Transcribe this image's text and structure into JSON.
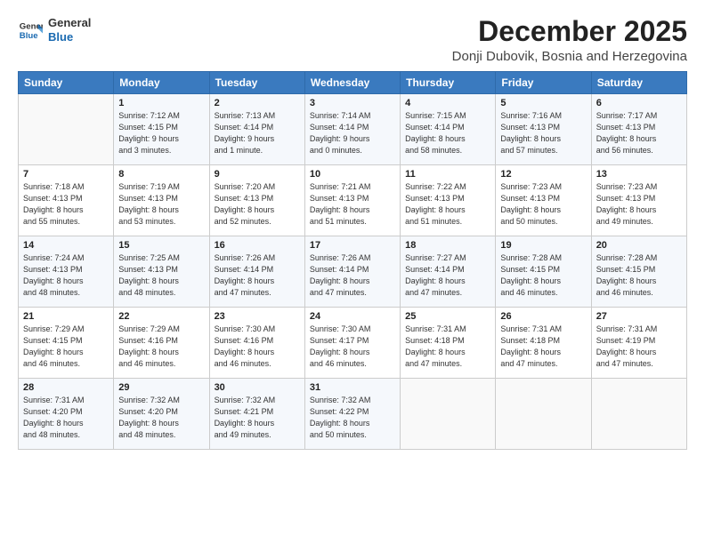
{
  "header": {
    "logo_line1": "General",
    "logo_line2": "Blue",
    "month": "December 2025",
    "location": "Donji Dubovik, Bosnia and Herzegovina"
  },
  "weekdays": [
    "Sunday",
    "Monday",
    "Tuesday",
    "Wednesday",
    "Thursday",
    "Friday",
    "Saturday"
  ],
  "weeks": [
    [
      {
        "day": "",
        "info": ""
      },
      {
        "day": "1",
        "info": "Sunrise: 7:12 AM\nSunset: 4:15 PM\nDaylight: 9 hours\nand 3 minutes."
      },
      {
        "day": "2",
        "info": "Sunrise: 7:13 AM\nSunset: 4:14 PM\nDaylight: 9 hours\nand 1 minute."
      },
      {
        "day": "3",
        "info": "Sunrise: 7:14 AM\nSunset: 4:14 PM\nDaylight: 9 hours\nand 0 minutes."
      },
      {
        "day": "4",
        "info": "Sunrise: 7:15 AM\nSunset: 4:14 PM\nDaylight: 8 hours\nand 58 minutes."
      },
      {
        "day": "5",
        "info": "Sunrise: 7:16 AM\nSunset: 4:13 PM\nDaylight: 8 hours\nand 57 minutes."
      },
      {
        "day": "6",
        "info": "Sunrise: 7:17 AM\nSunset: 4:13 PM\nDaylight: 8 hours\nand 56 minutes."
      }
    ],
    [
      {
        "day": "7",
        "info": "Sunrise: 7:18 AM\nSunset: 4:13 PM\nDaylight: 8 hours\nand 55 minutes."
      },
      {
        "day": "8",
        "info": "Sunrise: 7:19 AM\nSunset: 4:13 PM\nDaylight: 8 hours\nand 53 minutes."
      },
      {
        "day": "9",
        "info": "Sunrise: 7:20 AM\nSunset: 4:13 PM\nDaylight: 8 hours\nand 52 minutes."
      },
      {
        "day": "10",
        "info": "Sunrise: 7:21 AM\nSunset: 4:13 PM\nDaylight: 8 hours\nand 51 minutes."
      },
      {
        "day": "11",
        "info": "Sunrise: 7:22 AM\nSunset: 4:13 PM\nDaylight: 8 hours\nand 51 minutes."
      },
      {
        "day": "12",
        "info": "Sunrise: 7:23 AM\nSunset: 4:13 PM\nDaylight: 8 hours\nand 50 minutes."
      },
      {
        "day": "13",
        "info": "Sunrise: 7:23 AM\nSunset: 4:13 PM\nDaylight: 8 hours\nand 49 minutes."
      }
    ],
    [
      {
        "day": "14",
        "info": "Sunrise: 7:24 AM\nSunset: 4:13 PM\nDaylight: 8 hours\nand 48 minutes."
      },
      {
        "day": "15",
        "info": "Sunrise: 7:25 AM\nSunset: 4:13 PM\nDaylight: 8 hours\nand 48 minutes."
      },
      {
        "day": "16",
        "info": "Sunrise: 7:26 AM\nSunset: 4:14 PM\nDaylight: 8 hours\nand 47 minutes."
      },
      {
        "day": "17",
        "info": "Sunrise: 7:26 AM\nSunset: 4:14 PM\nDaylight: 8 hours\nand 47 minutes."
      },
      {
        "day": "18",
        "info": "Sunrise: 7:27 AM\nSunset: 4:14 PM\nDaylight: 8 hours\nand 47 minutes."
      },
      {
        "day": "19",
        "info": "Sunrise: 7:28 AM\nSunset: 4:15 PM\nDaylight: 8 hours\nand 46 minutes."
      },
      {
        "day": "20",
        "info": "Sunrise: 7:28 AM\nSunset: 4:15 PM\nDaylight: 8 hours\nand 46 minutes."
      }
    ],
    [
      {
        "day": "21",
        "info": "Sunrise: 7:29 AM\nSunset: 4:15 PM\nDaylight: 8 hours\nand 46 minutes."
      },
      {
        "day": "22",
        "info": "Sunrise: 7:29 AM\nSunset: 4:16 PM\nDaylight: 8 hours\nand 46 minutes."
      },
      {
        "day": "23",
        "info": "Sunrise: 7:30 AM\nSunset: 4:16 PM\nDaylight: 8 hours\nand 46 minutes."
      },
      {
        "day": "24",
        "info": "Sunrise: 7:30 AM\nSunset: 4:17 PM\nDaylight: 8 hours\nand 46 minutes."
      },
      {
        "day": "25",
        "info": "Sunrise: 7:31 AM\nSunset: 4:18 PM\nDaylight: 8 hours\nand 47 minutes."
      },
      {
        "day": "26",
        "info": "Sunrise: 7:31 AM\nSunset: 4:18 PM\nDaylight: 8 hours\nand 47 minutes."
      },
      {
        "day": "27",
        "info": "Sunrise: 7:31 AM\nSunset: 4:19 PM\nDaylight: 8 hours\nand 47 minutes."
      }
    ],
    [
      {
        "day": "28",
        "info": "Sunrise: 7:31 AM\nSunset: 4:20 PM\nDaylight: 8 hours\nand 48 minutes."
      },
      {
        "day": "29",
        "info": "Sunrise: 7:32 AM\nSunset: 4:20 PM\nDaylight: 8 hours\nand 48 minutes."
      },
      {
        "day": "30",
        "info": "Sunrise: 7:32 AM\nSunset: 4:21 PM\nDaylight: 8 hours\nand 49 minutes."
      },
      {
        "day": "31",
        "info": "Sunrise: 7:32 AM\nSunset: 4:22 PM\nDaylight: 8 hours\nand 50 minutes."
      },
      {
        "day": "",
        "info": ""
      },
      {
        "day": "",
        "info": ""
      },
      {
        "day": "",
        "info": ""
      }
    ]
  ]
}
